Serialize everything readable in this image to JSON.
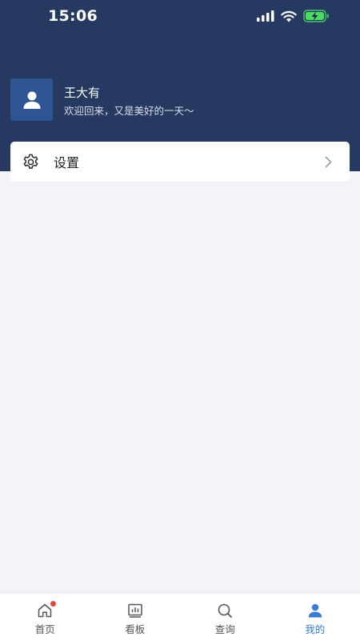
{
  "status_bar": {
    "time": "15:06",
    "icons": [
      "signal-icon",
      "wifi-icon",
      "battery-charging-icon"
    ]
  },
  "profile": {
    "name": "王大有",
    "welcome": "欢迎回来，又是美好的一天～",
    "avatar_icon": "user-icon"
  },
  "settings": {
    "label": "设置",
    "icon": "gear-icon"
  },
  "bottom_nav": {
    "items": [
      {
        "label": "首页",
        "icon": "home-icon",
        "badge": true,
        "active": false
      },
      {
        "label": "看板",
        "icon": "chart-board-icon",
        "active": false
      },
      {
        "label": "查询",
        "icon": "search-icon",
        "active": false
      },
      {
        "label": "我的",
        "icon": "user-icon",
        "active": true
      }
    ]
  },
  "colors": {
    "header": "#263a61",
    "avatar": "#2e5494",
    "accent": "#3a7bd5",
    "background": "#f3f4f7",
    "badge": "#e8453c"
  }
}
